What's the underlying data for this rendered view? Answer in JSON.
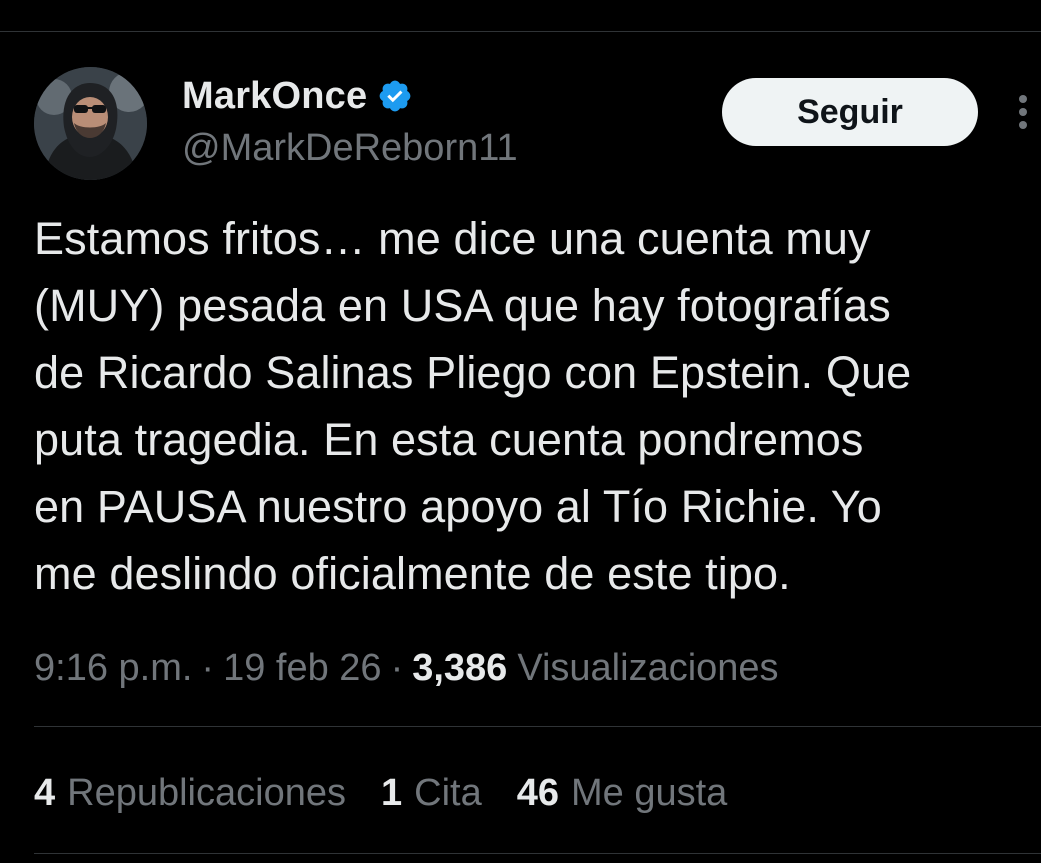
{
  "author": {
    "display_name": "MarkOnce",
    "handle": "@MarkDeReborn11",
    "verified_icon": "verified-badge-icon",
    "avatar_icon": "avatar-photo"
  },
  "actions": {
    "follow_label": "Seguir",
    "more_icon": "more-vertical-icon"
  },
  "tweet": {
    "text": "Estamos fritos… me dice una cuenta muy\n(MUY) pesada en USA que hay fotografías\nde Ricardo Salinas Pliego con Epstein. Que\nputa tragedia. En esta cuenta pondremos\nen PAUSA nuestro apoyo al Tío Richie. Yo\nme deslindo oficialmente de este tipo."
  },
  "meta": {
    "time": "9:16 p.m.",
    "separator": "·",
    "date": "19 feb 26",
    "views_count": "3,386",
    "views_label": "Visualizaciones"
  },
  "stats": {
    "reposts_count": "4",
    "reposts_label": "Republicaciones",
    "quotes_count": "1",
    "quotes_label": "Cita",
    "likes_count": "46",
    "likes_label": "Me gusta"
  },
  "colors": {
    "background": "#000000",
    "primary_text": "#e7e9ea",
    "secondary_text": "#71767b",
    "verified_blue": "#1d9bf0",
    "button_bg": "#eff3f4",
    "divider": "#2f3336"
  }
}
